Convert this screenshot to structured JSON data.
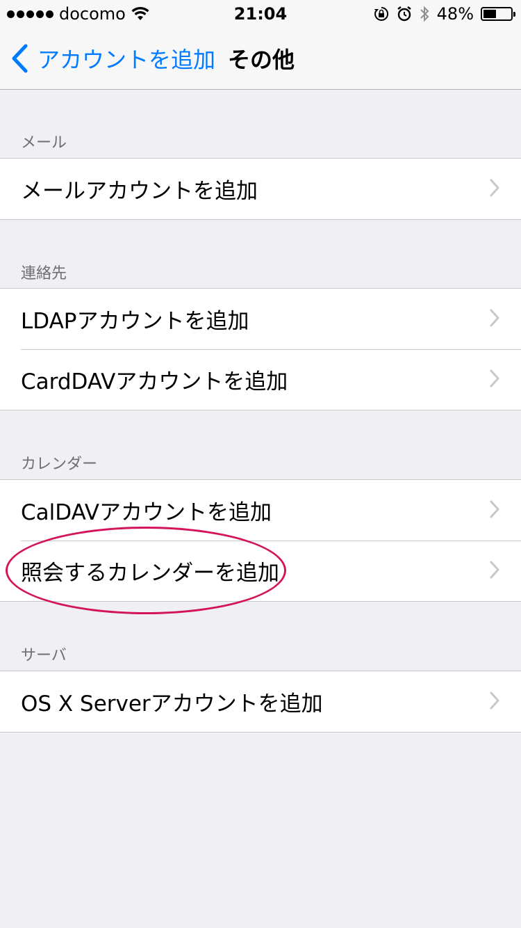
{
  "status_bar": {
    "carrier": "docomo",
    "time": "21:04",
    "battery_percent": "48%",
    "battery_level": 0.48,
    "icons": [
      "signal-dots-icon",
      "wifi-icon",
      "rotation-lock-icon",
      "alarm-icon",
      "bluetooth-icon",
      "battery-icon"
    ]
  },
  "nav": {
    "back_label": "アカウントを追加",
    "title": "その他"
  },
  "sections": {
    "mail": {
      "header": "メール",
      "items": [
        "メールアカウントを追加"
      ]
    },
    "contacts": {
      "header": "連絡先",
      "items": [
        "LDAPアカウントを追加",
        "CardDAVアカウントを追加"
      ]
    },
    "calendar": {
      "header": "カレンダー",
      "items": [
        "CalDAVアカウントを追加",
        "照会するカレンダーを追加"
      ]
    },
    "server": {
      "header": "サーバ",
      "items": [
        "OS X Serverアカウントを追加"
      ]
    }
  },
  "colors": {
    "tint": "#007aff",
    "background": "#efeff4",
    "annotation": "#d4145a"
  }
}
